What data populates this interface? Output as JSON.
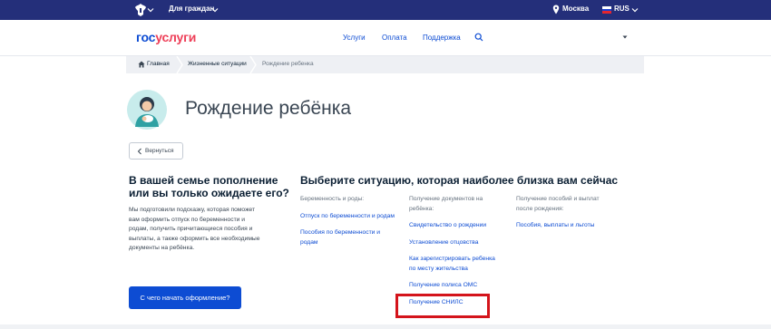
{
  "topbar": {
    "audience": "Для граждан",
    "city": "Москва",
    "language": "RUS",
    "colors": {
      "background": "#242f7a"
    }
  },
  "header": {
    "logo_part1": "гос",
    "logo_part2": "услуги",
    "nav": [
      "Услуги",
      "Оплата",
      "Поддержка"
    ],
    "icons": [
      "search-icon",
      "chevron-down-icon"
    ]
  },
  "breadcrumb": {
    "items": [
      "Главная",
      "Жизненные ситуации",
      "Рождение ребенка"
    ]
  },
  "page": {
    "title": "Рождение ребёнка",
    "back_label": "Вернуться"
  },
  "left": {
    "title": "В вашей семье пополнение или вы только ожидаете его?",
    "description": "Мы подготовили подсказку, которая поможет вам оформить отпуск по беременности и родам, получить причитающиеся пособия и выплаты, а также оформить все необходимые документы на ребёнка.",
    "button": "С чего начать оформление?"
  },
  "situations": {
    "title": "Выберите ситуацию, которая наиболее близка вам сейчас",
    "columns": [
      {
        "heading": "Беременность и роды:",
        "links": [
          "Отпуск по беременности и родам",
          "Пособия по беременности и родам"
        ]
      },
      {
        "heading": "Получение документов на ребёнка:",
        "links": [
          "Свидетельство о рождении",
          "Установление отцовства",
          "Как зарегистрировать ребенка по месту жительства",
          "Получение полиса ОМС",
          "Получение СНИЛС"
        ]
      },
      {
        "heading": "Получение пособий и выплат после рождения:",
        "links": [
          "Пособия, выплаты и льготы"
        ]
      }
    ]
  },
  "colors": {
    "accent": "#0d4cd3",
    "logo_red": "#ee3f58",
    "highlight": "#d4141b"
  }
}
